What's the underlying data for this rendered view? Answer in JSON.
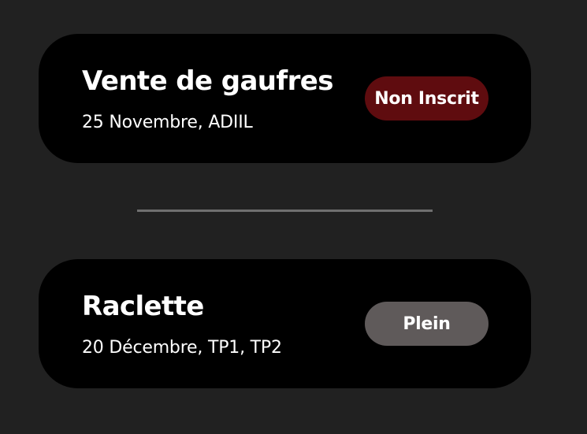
{
  "events": [
    {
      "title": "Vente de gaufres",
      "meta": "25 Novembre, ADIIL",
      "status_label": "Non Inscrit",
      "status_color": "#5f0c0f"
    },
    {
      "title": "Raclette",
      "meta": "20 Décembre, TP1, TP2",
      "status_label": "Plein",
      "status_color": "#5f5a5a"
    }
  ],
  "colors": {
    "background": "#212121",
    "card": "#000000",
    "divider": "#6f6f6f",
    "text": "#ffffff"
  }
}
